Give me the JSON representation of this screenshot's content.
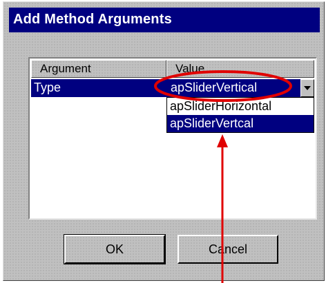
{
  "window": {
    "title": "Add Method Arguments"
  },
  "list": {
    "columns": [
      "Argument",
      "Value"
    ],
    "rows": [
      {
        "argument": "Type",
        "value": "apSliderVertical"
      }
    ]
  },
  "dropdown": {
    "options": [
      "apSliderHorizontal",
      "apSliderVertcal"
    ],
    "selected_index": 1
  },
  "buttons": {
    "ok": "OK",
    "cancel": "Cancel"
  },
  "colors": {
    "titlebar": "#000080",
    "selection": "#000080",
    "dialog": "#c0c0c0",
    "annotation": "#e00000"
  },
  "icons": {
    "dropdown_button": "chevron-down-icon"
  }
}
